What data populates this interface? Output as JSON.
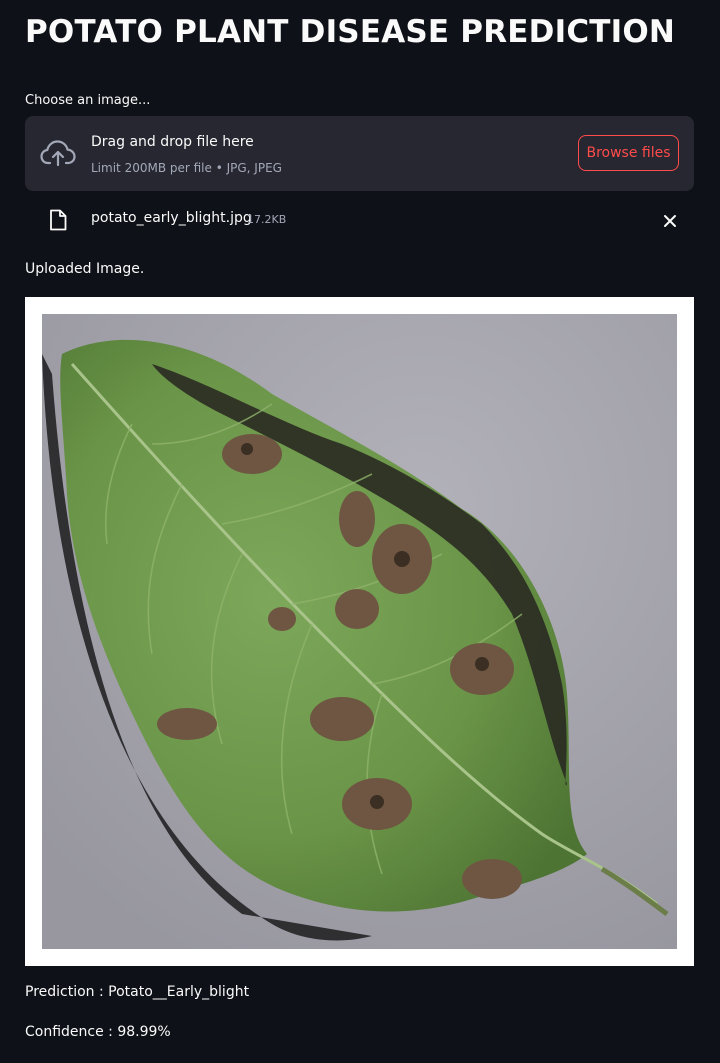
{
  "page": {
    "title": "POTATO PLANT DISEASE PREDICTION"
  },
  "uploader": {
    "label": "Choose an image...",
    "drop_text": "Drag and drop file here",
    "limit_text": "Limit 200MB per file • JPG, JPEG",
    "browse_label": "Browse files",
    "icon": "cloud-upload-icon"
  },
  "uploaded_file": {
    "name": "potato_early_blight.jpg",
    "size": "17.2KB",
    "file_icon": "file-icon",
    "remove_icon": "close-icon"
  },
  "image_section": {
    "caption": "Uploaded Image.",
    "image_subject": "potato leaf with early blight lesions"
  },
  "result": {
    "prediction": "Prediction : Potato__Early_blight",
    "confidence": "Confidence : 98.99%"
  },
  "colors": {
    "background": "#0e1117",
    "surface": "#262730",
    "accent": "#ff4b4b",
    "text": "#fafafa",
    "muted_text": "#a3a8b8"
  }
}
